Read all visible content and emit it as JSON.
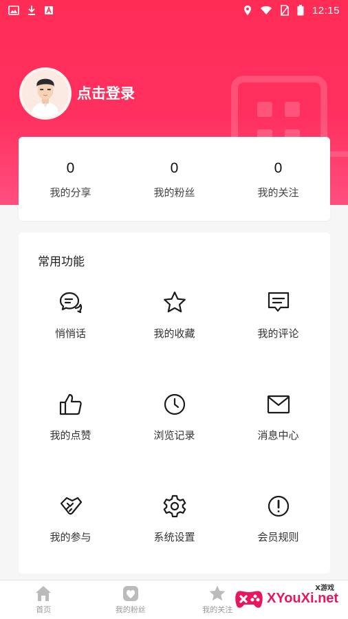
{
  "status_bar": {
    "time": "12:15",
    "left_icons": [
      "image-icon",
      "download-icon",
      "font-icon"
    ],
    "right_icons": [
      "location-icon",
      "wifi-icon",
      "no-sim-icon",
      "battery-icon"
    ]
  },
  "profile": {
    "login_label": "点击登录"
  },
  "stats": [
    {
      "value": "0",
      "label": "我的分享"
    },
    {
      "value": "0",
      "label": "我的粉丝"
    },
    {
      "value": "0",
      "label": "我的关注"
    }
  ],
  "functions": {
    "title": "常用功能",
    "items": [
      {
        "label": "悄悄话",
        "icon": "chat-icon"
      },
      {
        "label": "我的收藏",
        "icon": "star-icon"
      },
      {
        "label": "我的评论",
        "icon": "comment-icon"
      },
      {
        "label": "我的点赞",
        "icon": "thumbs-up-icon"
      },
      {
        "label": "浏览记录",
        "icon": "clock-icon"
      },
      {
        "label": "消息中心",
        "icon": "mail-icon"
      },
      {
        "label": "我的参与",
        "icon": "handshake-icon"
      },
      {
        "label": "系统设置",
        "icon": "gear-icon"
      },
      {
        "label": "会员规则",
        "icon": "alert-icon"
      }
    ]
  },
  "bottom_nav": [
    {
      "label": "首页",
      "icon": "home-icon"
    },
    {
      "label": "我的粉丝",
      "icon": "heart-icon"
    },
    {
      "label": "我的关注",
      "icon": "star-icon"
    }
  ],
  "watermark": {
    "brand": "XYouXi.net",
    "small": "X游戏"
  },
  "colors": {
    "accent": "#ff2d56",
    "icon": "#1a1a1a",
    "nav_inactive": "#bbbbbb"
  }
}
